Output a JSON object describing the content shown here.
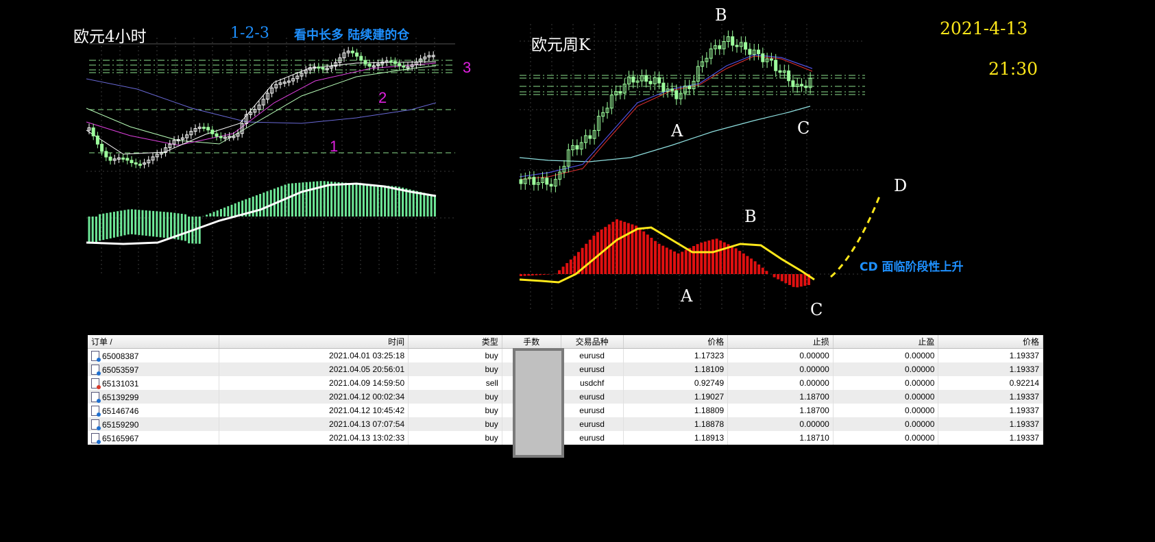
{
  "left_chart": {
    "title": "欧元4小时",
    "pattern_label": "1-2-3",
    "note": "看中长多 陆续建的仓",
    "wave_labels": [
      "1",
      "2",
      "3"
    ]
  },
  "right_chart": {
    "title": "欧元周K",
    "price_labels": {
      "b": "B",
      "a": "A",
      "c": "C"
    },
    "macd_labels": {
      "b": "B",
      "a": "A",
      "c": "C",
      "d": "D"
    },
    "cd_note": "CD 面临阶段性上升"
  },
  "timestamp": {
    "date": "2021-4-13",
    "time": "21:30"
  },
  "colors": {
    "background": "#000000",
    "date_text": "#ffe81a",
    "note_text": "#1e90ff",
    "wave_label": "#e020e0",
    "grid": "#3c8c50",
    "bull_candle": "#ffffff",
    "bear_candle": "#9dff9d",
    "macd_green": "#6ee898",
    "macd_red": "#e01010",
    "macd_signal": "#ffe81a"
  },
  "orders": {
    "headers": [
      "订单 /",
      "时间",
      "类型",
      "手数",
      "交易品种",
      "价格",
      "止损",
      "止盈",
      "价格"
    ],
    "rows": [
      {
        "id": "65008387",
        "time": "2021.04.01 03:25:18",
        "type": "buy",
        "lots": "",
        "symbol": "eurusd",
        "price": "1.17323",
        "sl": "0.00000",
        "tp": "0.00000",
        "current": "1.19337"
      },
      {
        "id": "65053597",
        "time": "2021.04.05 20:56:01",
        "type": "buy",
        "lots": "",
        "symbol": "eurusd",
        "price": "1.18109",
        "sl": "0.00000",
        "tp": "0.00000",
        "current": "1.19337"
      },
      {
        "id": "65131031",
        "time": "2021.04.09 14:59:50",
        "type": "sell",
        "lots": "",
        "symbol": "usdchf",
        "price": "0.92749",
        "sl": "0.00000",
        "tp": "0.00000",
        "current": "0.92214"
      },
      {
        "id": "65139299",
        "time": "2021.04.12 00:02:34",
        "type": "buy",
        "lots": "",
        "symbol": "eurusd",
        "price": "1.19027",
        "sl": "1.18700",
        "tp": "0.00000",
        "current": "1.19337"
      },
      {
        "id": "65146746",
        "time": "2021.04.12 10:45:42",
        "type": "buy",
        "lots": "",
        "symbol": "eurusd",
        "price": "1.18809",
        "sl": "1.18700",
        "tp": "0.00000",
        "current": "1.19337"
      },
      {
        "id": "65159290",
        "time": "2021.04.13 07:07:54",
        "type": "buy",
        "lots": "",
        "symbol": "eurusd",
        "price": "1.18878",
        "sl": "0.00000",
        "tp": "0.00000",
        "current": "1.19337"
      },
      {
        "id": "65165967",
        "time": "2021.04.13 13:02:33",
        "type": "buy",
        "lots": "",
        "symbol": "eurusd",
        "price": "1.18913",
        "sl": "1.18710",
        "tp": "0.00000",
        "current": "1.19337"
      }
    ]
  }
}
